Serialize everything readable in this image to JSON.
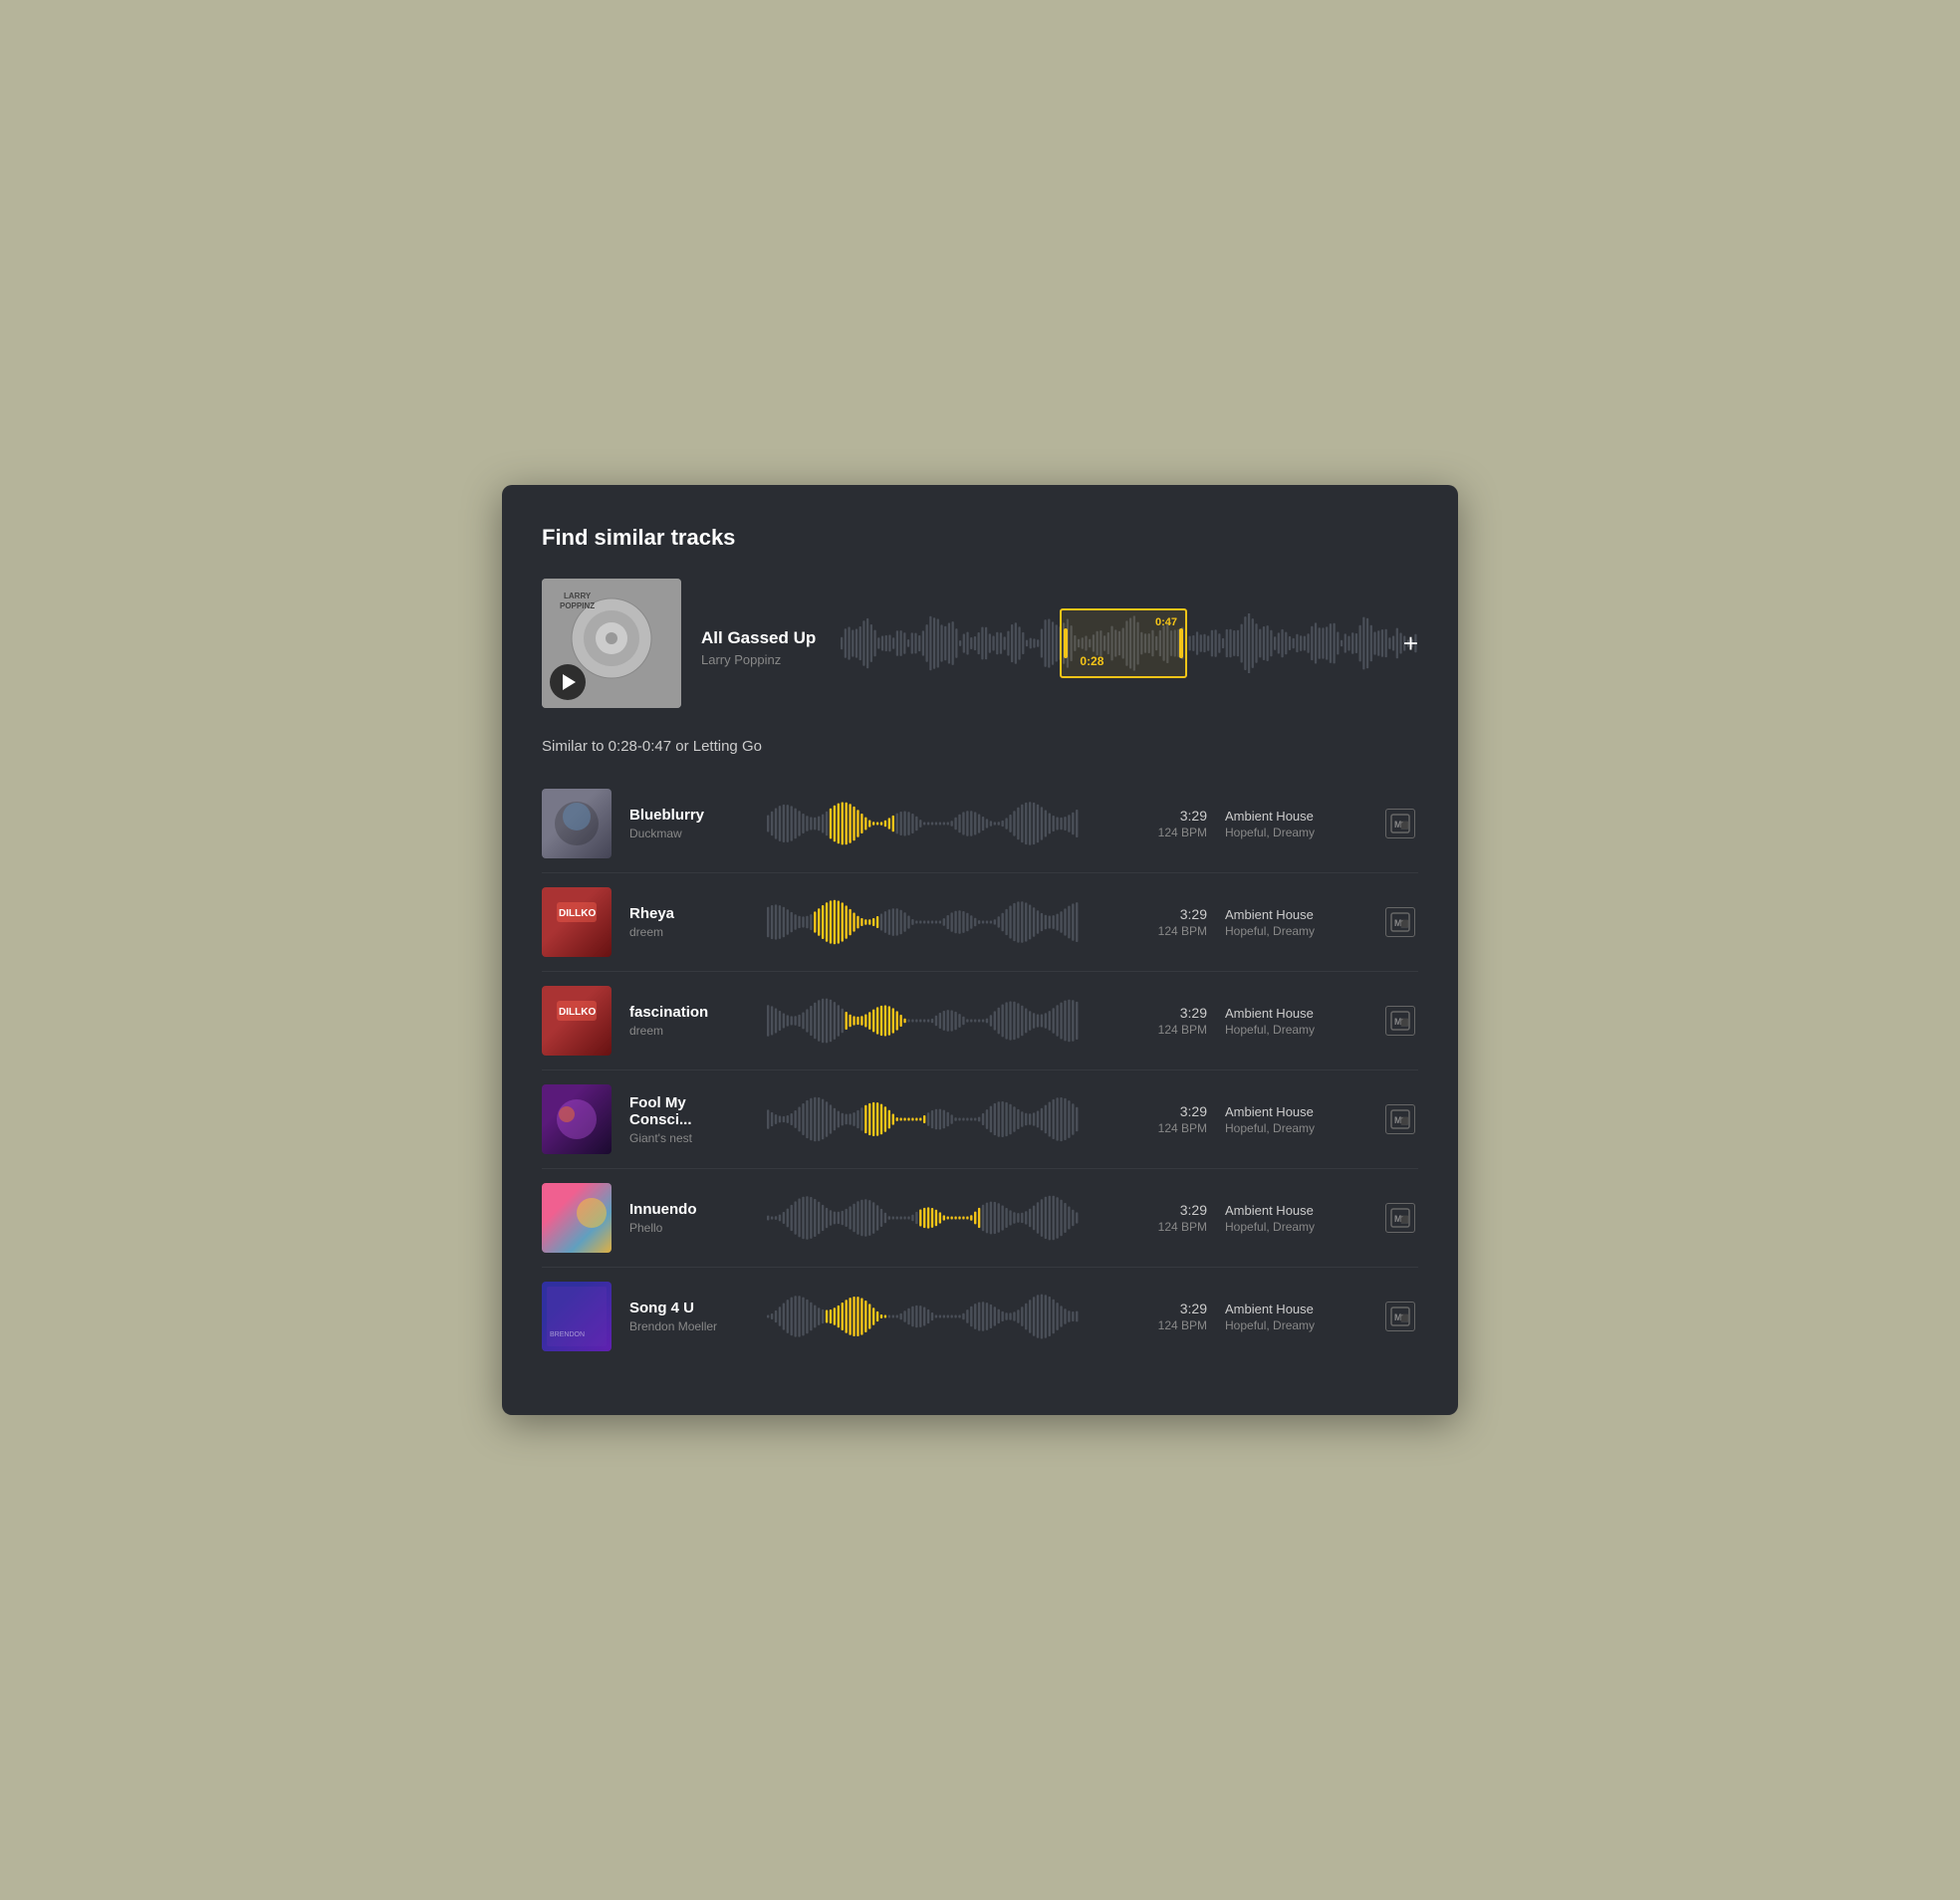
{
  "panel": {
    "title": "Find similar tracks"
  },
  "source_track": {
    "title": "All Gassed Up",
    "artist": "Larry Poppinz",
    "selection_start": "0:28",
    "selection_end": "0:47",
    "play_label": "▶"
  },
  "similar_label": "Similar to 0:28-0:47 or Letting Go",
  "add_button_label": "+",
  "tracks": [
    {
      "name": "Blueblurry",
      "artist": "Duckmaw",
      "duration": "3:29",
      "bpm": "124 BPM",
      "genre": "Ambient House",
      "mood": "Hopeful, Dreamy",
      "thumb_class": "thumb-blueblurry",
      "highlight_pos": 0.3
    },
    {
      "name": "Rheya",
      "artist": "dreem",
      "duration": "3:29",
      "bpm": "124 BPM",
      "genre": "Ambient House",
      "mood": "Hopeful, Dreamy",
      "thumb_class": "thumb-rheya",
      "highlight_pos": 0.25
    },
    {
      "name": "fascination",
      "artist": "dreem",
      "duration": "3:29",
      "bpm": "124 BPM",
      "genre": "Ambient House",
      "mood": "Hopeful, Dreamy",
      "thumb_class": "thumb-fascination",
      "highlight_pos": 0.35
    },
    {
      "name": "Fool My Consci...",
      "artist": "Giant's nest",
      "duration": "3:29",
      "bpm": "124 BPM",
      "genre": "Ambient House",
      "mood": "Hopeful, Dreamy",
      "thumb_class": "thumb-fool",
      "highlight_pos": 0.4
    },
    {
      "name": "Innuendo",
      "artist": "Phello",
      "duration": "3:29",
      "bpm": "124 BPM",
      "genre": "Ambient House",
      "mood": "Hopeful, Dreamy",
      "thumb_class": "thumb-innuendo",
      "highlight_pos": 0.58
    },
    {
      "name": "Song 4 U",
      "artist": "Brendon Moeller",
      "duration": "3:29",
      "bpm": "124 BPM",
      "genre": "Ambient House",
      "mood": "Hopeful, Dreamy",
      "thumb_class": "thumb-song4u",
      "highlight_pos": 0.28
    }
  ],
  "colors": {
    "accent": "#f5c518",
    "dark_bg": "#2a2d33",
    "waveform_default": "#4a4f58",
    "waveform_highlight": "#f5c518"
  }
}
